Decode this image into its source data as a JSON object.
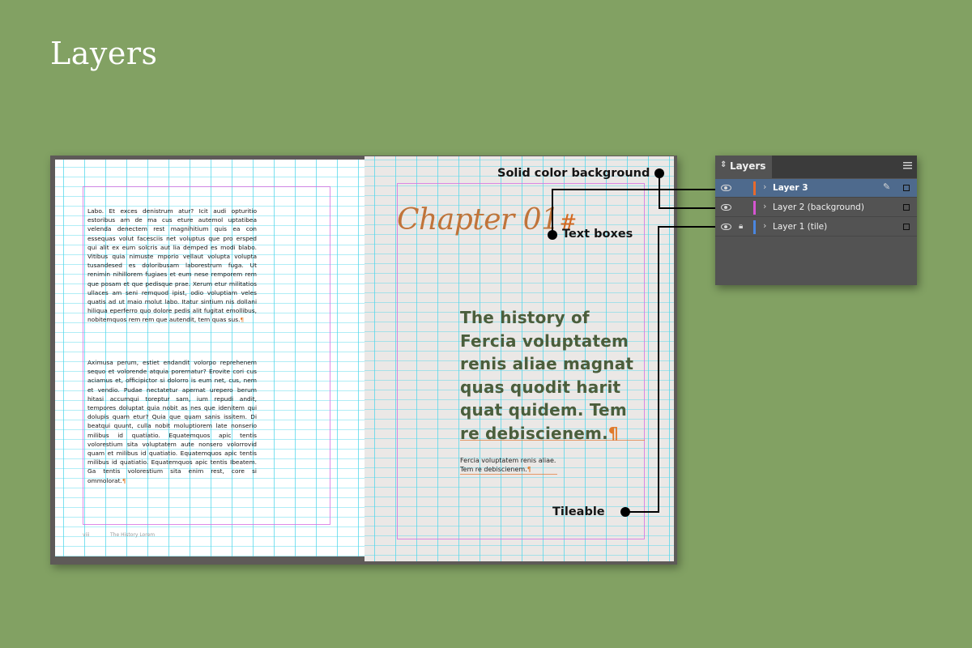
{
  "heading": "Layers",
  "left_page": {
    "paragraph_1": "Labo. Et exces denistrum atur? Icit audi opturitio estoribus am de ma cus eture autemol uptatibea velenda denectem rest magnihitium quis ea con essequas volut facesciis net voluptus que pro ersped qui alit ex eum solcris aut lia demped es modi blabo. Vitibus quia nimuste mporio vellaut volupta volupta tusandesed es doloribusam laborestrum fuga. Ut renimin nihillorem fugiaes et eum nese remporem rem que posam et que pedisque prae. Xerum etur militatios ullaces am seni remquod ipist, odio voluptiam veles quatis ad ut maio molut labo. Itatur sintium nis dollani hiliqua eperferro quo dolore pedis alit fugitat emollibus, nobitemquos rem rem que autendit, tem quas sus.",
    "paragraph_2": "Aximusa perum, estiet endandit volorpo reprehenem sequo et volorende atquia porernatur? Erovite cori cus aciamus et, officipictor si dolorro is eum net, cus, nem et vendio. Pudae nectatetur apernat urepero berum hitasi accumqui toreptur sam, ium repudi andit, tempores doluptat quia nobit as nes que idenitem qui dolupis quam etur? Quia que quam sanis issitem. Di beatqui quunt, culla nobit moluptiorem late nonserio milibus id quatiatio. Equatemquos apic tentis volorestium sita voluptatem aute nonsero volorrovid quam et milibus id quatiatio. Equatemquos apic tentis milibus id quatiatio. Equatemquos apic tentis Ibeatem. Ga tentis volorestium sita enim rest, core si ommolorat.",
    "pilcrow": "¶",
    "footer_number": "viii",
    "footer_title": "The History Lorem"
  },
  "right_page": {
    "chapter": "Chapter 01",
    "chapter_mark": "#",
    "headline": "The history of\nFercia voluptatem\nrenis aliae magnat\nquas quodit harit\nquat quidem. Tem\nre debiscienem.",
    "pilcrow": "¶",
    "subtext": "Fercia voluptatem renis aliae.\nTem re debiscienem."
  },
  "annotations": {
    "solid_color": "Solid color background",
    "text_boxes": "Text boxes",
    "tileable": "Tileable"
  },
  "layers_panel": {
    "title": "Layers",
    "collapse_icon": "double-chevron",
    "menu_icon": "hamburger",
    "layers": [
      {
        "name": "Layer 3",
        "color": "#e86a2c",
        "selected": true,
        "locked": false,
        "visible": true
      },
      {
        "name": "Layer 2 (background)",
        "color": "#d655d2",
        "selected": false,
        "locked": false,
        "visible": true
      },
      {
        "name": "Layer 1 (tile)",
        "color": "#4a86e0",
        "selected": false,
        "locked": true,
        "visible": true
      }
    ]
  },
  "colors": {
    "background": "#82a163",
    "chapter": "#c0743a",
    "headline": "#4b5e3c",
    "selection": "#4e6a8d"
  }
}
